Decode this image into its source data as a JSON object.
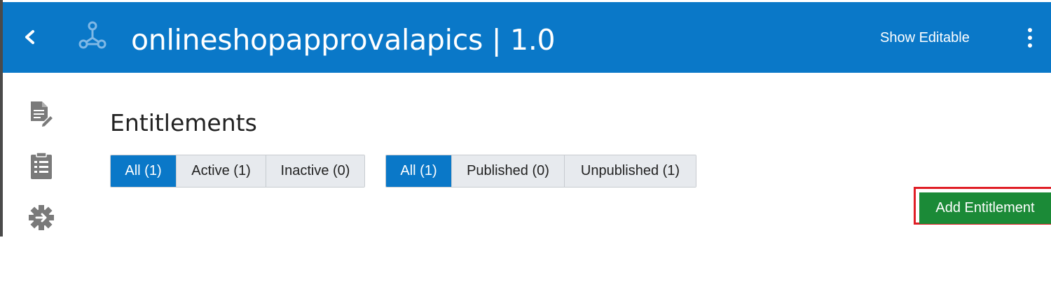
{
  "header": {
    "title": "onlineshopapprovalapics | 1.0",
    "show_editable_label": "Show Editable",
    "background": "#0a78c8"
  },
  "sidebar": {
    "items": [
      {
        "icon": "document-edit-icon"
      },
      {
        "icon": "clipboard-list-icon"
      },
      {
        "icon": "settings-gear-icon"
      }
    ]
  },
  "main": {
    "section_title": "Entitlements",
    "status_filter": [
      {
        "label": "All (1)",
        "active": true
      },
      {
        "label": "Active (1)",
        "active": false
      },
      {
        "label": "Inactive (0)",
        "active": false
      }
    ],
    "publish_filter": [
      {
        "label": "All (1)",
        "active": true
      },
      {
        "label": "Published (0)",
        "active": false
      },
      {
        "label": "Unpublished (1)",
        "active": false
      }
    ],
    "add_button_label": "Add Entitlement",
    "add_button_color": "#1b8a37",
    "highlight_color": "#e01e26"
  }
}
